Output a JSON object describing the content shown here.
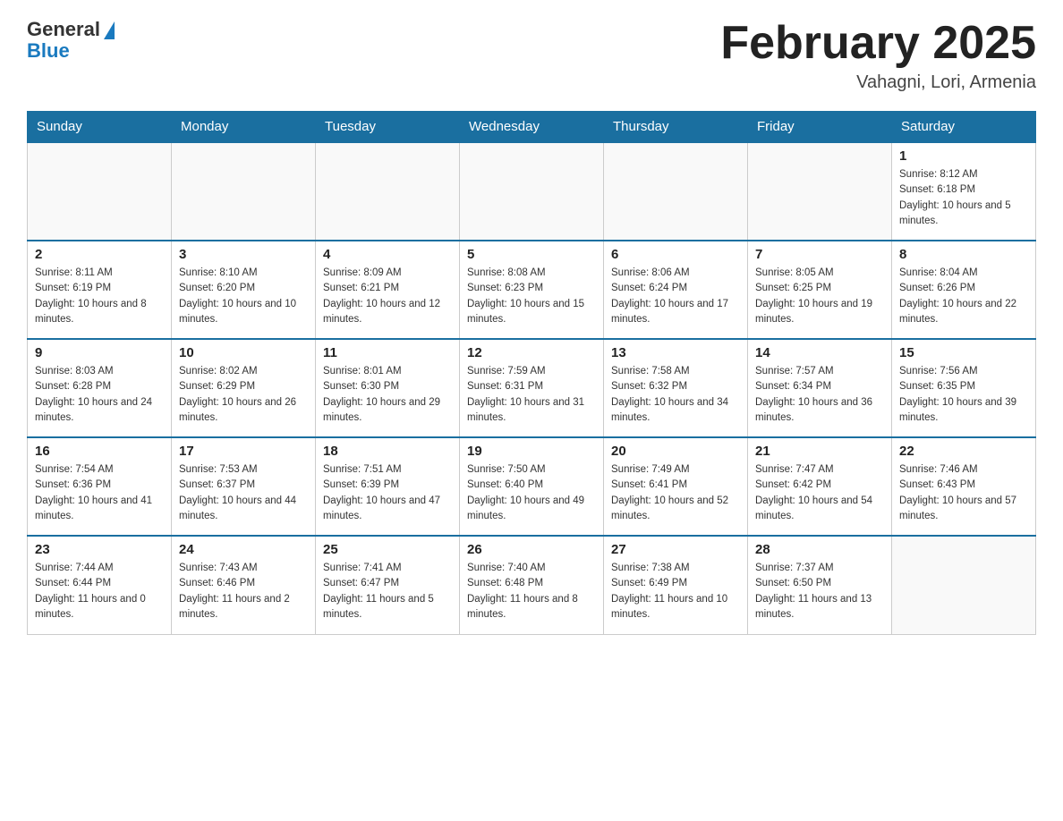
{
  "header": {
    "logo_general": "General",
    "logo_blue": "Blue",
    "title": "February 2025",
    "location": "Vahagni, Lori, Armenia"
  },
  "weekdays": [
    "Sunday",
    "Monday",
    "Tuesday",
    "Wednesday",
    "Thursday",
    "Friday",
    "Saturday"
  ],
  "weeks": [
    [
      {
        "day": "",
        "sunrise": "",
        "sunset": "",
        "daylight": ""
      },
      {
        "day": "",
        "sunrise": "",
        "sunset": "",
        "daylight": ""
      },
      {
        "day": "",
        "sunrise": "",
        "sunset": "",
        "daylight": ""
      },
      {
        "day": "",
        "sunrise": "",
        "sunset": "",
        "daylight": ""
      },
      {
        "day": "",
        "sunrise": "",
        "sunset": "",
        "daylight": ""
      },
      {
        "day": "",
        "sunrise": "",
        "sunset": "",
        "daylight": ""
      },
      {
        "day": "1",
        "sunrise": "Sunrise: 8:12 AM",
        "sunset": "Sunset: 6:18 PM",
        "daylight": "Daylight: 10 hours and 5 minutes."
      }
    ],
    [
      {
        "day": "2",
        "sunrise": "Sunrise: 8:11 AM",
        "sunset": "Sunset: 6:19 PM",
        "daylight": "Daylight: 10 hours and 8 minutes."
      },
      {
        "day": "3",
        "sunrise": "Sunrise: 8:10 AM",
        "sunset": "Sunset: 6:20 PM",
        "daylight": "Daylight: 10 hours and 10 minutes."
      },
      {
        "day": "4",
        "sunrise": "Sunrise: 8:09 AM",
        "sunset": "Sunset: 6:21 PM",
        "daylight": "Daylight: 10 hours and 12 minutes."
      },
      {
        "day": "5",
        "sunrise": "Sunrise: 8:08 AM",
        "sunset": "Sunset: 6:23 PM",
        "daylight": "Daylight: 10 hours and 15 minutes."
      },
      {
        "day": "6",
        "sunrise": "Sunrise: 8:06 AM",
        "sunset": "Sunset: 6:24 PM",
        "daylight": "Daylight: 10 hours and 17 minutes."
      },
      {
        "day": "7",
        "sunrise": "Sunrise: 8:05 AM",
        "sunset": "Sunset: 6:25 PM",
        "daylight": "Daylight: 10 hours and 19 minutes."
      },
      {
        "day": "8",
        "sunrise": "Sunrise: 8:04 AM",
        "sunset": "Sunset: 6:26 PM",
        "daylight": "Daylight: 10 hours and 22 minutes."
      }
    ],
    [
      {
        "day": "9",
        "sunrise": "Sunrise: 8:03 AM",
        "sunset": "Sunset: 6:28 PM",
        "daylight": "Daylight: 10 hours and 24 minutes."
      },
      {
        "day": "10",
        "sunrise": "Sunrise: 8:02 AM",
        "sunset": "Sunset: 6:29 PM",
        "daylight": "Daylight: 10 hours and 26 minutes."
      },
      {
        "day": "11",
        "sunrise": "Sunrise: 8:01 AM",
        "sunset": "Sunset: 6:30 PM",
        "daylight": "Daylight: 10 hours and 29 minutes."
      },
      {
        "day": "12",
        "sunrise": "Sunrise: 7:59 AM",
        "sunset": "Sunset: 6:31 PM",
        "daylight": "Daylight: 10 hours and 31 minutes."
      },
      {
        "day": "13",
        "sunrise": "Sunrise: 7:58 AM",
        "sunset": "Sunset: 6:32 PM",
        "daylight": "Daylight: 10 hours and 34 minutes."
      },
      {
        "day": "14",
        "sunrise": "Sunrise: 7:57 AM",
        "sunset": "Sunset: 6:34 PM",
        "daylight": "Daylight: 10 hours and 36 minutes."
      },
      {
        "day": "15",
        "sunrise": "Sunrise: 7:56 AM",
        "sunset": "Sunset: 6:35 PM",
        "daylight": "Daylight: 10 hours and 39 minutes."
      }
    ],
    [
      {
        "day": "16",
        "sunrise": "Sunrise: 7:54 AM",
        "sunset": "Sunset: 6:36 PM",
        "daylight": "Daylight: 10 hours and 41 minutes."
      },
      {
        "day": "17",
        "sunrise": "Sunrise: 7:53 AM",
        "sunset": "Sunset: 6:37 PM",
        "daylight": "Daylight: 10 hours and 44 minutes."
      },
      {
        "day": "18",
        "sunrise": "Sunrise: 7:51 AM",
        "sunset": "Sunset: 6:39 PM",
        "daylight": "Daylight: 10 hours and 47 minutes."
      },
      {
        "day": "19",
        "sunrise": "Sunrise: 7:50 AM",
        "sunset": "Sunset: 6:40 PM",
        "daylight": "Daylight: 10 hours and 49 minutes."
      },
      {
        "day": "20",
        "sunrise": "Sunrise: 7:49 AM",
        "sunset": "Sunset: 6:41 PM",
        "daylight": "Daylight: 10 hours and 52 minutes."
      },
      {
        "day": "21",
        "sunrise": "Sunrise: 7:47 AM",
        "sunset": "Sunset: 6:42 PM",
        "daylight": "Daylight: 10 hours and 54 minutes."
      },
      {
        "day": "22",
        "sunrise": "Sunrise: 7:46 AM",
        "sunset": "Sunset: 6:43 PM",
        "daylight": "Daylight: 10 hours and 57 minutes."
      }
    ],
    [
      {
        "day": "23",
        "sunrise": "Sunrise: 7:44 AM",
        "sunset": "Sunset: 6:44 PM",
        "daylight": "Daylight: 11 hours and 0 minutes."
      },
      {
        "day": "24",
        "sunrise": "Sunrise: 7:43 AM",
        "sunset": "Sunset: 6:46 PM",
        "daylight": "Daylight: 11 hours and 2 minutes."
      },
      {
        "day": "25",
        "sunrise": "Sunrise: 7:41 AM",
        "sunset": "Sunset: 6:47 PM",
        "daylight": "Daylight: 11 hours and 5 minutes."
      },
      {
        "day": "26",
        "sunrise": "Sunrise: 7:40 AM",
        "sunset": "Sunset: 6:48 PM",
        "daylight": "Daylight: 11 hours and 8 minutes."
      },
      {
        "day": "27",
        "sunrise": "Sunrise: 7:38 AM",
        "sunset": "Sunset: 6:49 PM",
        "daylight": "Daylight: 11 hours and 10 minutes."
      },
      {
        "day": "28",
        "sunrise": "Sunrise: 7:37 AM",
        "sunset": "Sunset: 6:50 PM",
        "daylight": "Daylight: 11 hours and 13 minutes."
      },
      {
        "day": "",
        "sunrise": "",
        "sunset": "",
        "daylight": ""
      }
    ]
  ]
}
